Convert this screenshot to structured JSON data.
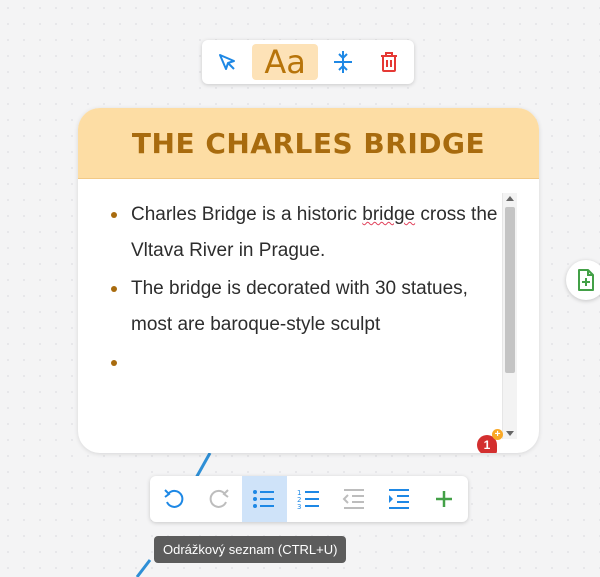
{
  "card": {
    "title": "THE CHARLES BRIDGE",
    "bullets": [
      {
        "before": "Charles Bridge is a historic ",
        "misspelled": "bridge",
        "after": " cross the Vltava River in Prague."
      },
      {
        "text": "The bridge is decorated with 30 statues, most are baroque-style sculpt"
      },
      {
        "text": ""
      }
    ],
    "comment_badge_count": "1"
  },
  "top_toolbar": {
    "aa_label": "Aa",
    "icons": [
      "select-pointer-icon",
      "text-style-icon",
      "vertical-align-icon",
      "delete-icon"
    ]
  },
  "bottom_toolbar": {
    "icons": [
      "undo-icon",
      "redo-icon",
      "bulleted-list-icon",
      "numbered-list-icon",
      "decrease-indent-icon",
      "increase-indent-icon",
      "add-icon"
    ],
    "active": "bulleted-list-icon"
  },
  "side_button": {
    "icon": "add-document-icon"
  },
  "tooltip": {
    "text": "Odrážkový seznam (CTRL+U)"
  },
  "colors": {
    "header_bg": "#fddda4",
    "title": "#a86b0e",
    "accent_blue": "#1e88e5",
    "delete_red": "#e53935",
    "add_green": "#43a047"
  }
}
